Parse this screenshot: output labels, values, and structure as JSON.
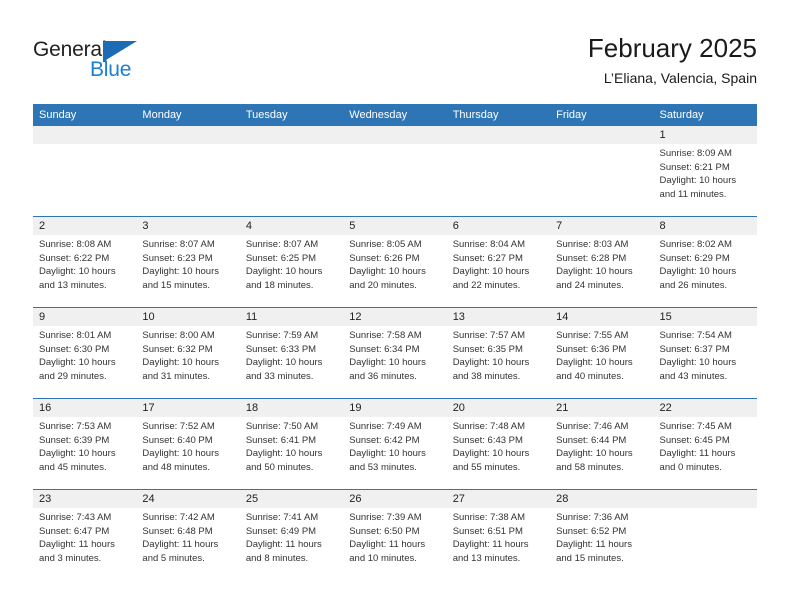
{
  "brand": {
    "name_part1": "General",
    "name_part2": "Blue",
    "accent_color": "#1b7fd4",
    "flag_color": "#1b6cb5"
  },
  "header": {
    "title": "February 2025",
    "subtitle": "L’Eliana, Valencia, Spain"
  },
  "theme": {
    "header_blue": "#2e75b6",
    "daynum_band": "#f0f0f0",
    "text": "#333333"
  },
  "calendar": {
    "weekdays": [
      "Sunday",
      "Monday",
      "Tuesday",
      "Wednesday",
      "Thursday",
      "Friday",
      "Saturday"
    ],
    "weeks": [
      [
        {
          "day": "",
          "lines": []
        },
        {
          "day": "",
          "lines": []
        },
        {
          "day": "",
          "lines": []
        },
        {
          "day": "",
          "lines": []
        },
        {
          "day": "",
          "lines": []
        },
        {
          "day": "",
          "lines": []
        },
        {
          "day": "1",
          "lines": [
            "Sunrise: 8:09 AM",
            "Sunset: 6:21 PM",
            "Daylight: 10 hours",
            "and 11 minutes."
          ]
        }
      ],
      [
        {
          "day": "2",
          "lines": [
            "Sunrise: 8:08 AM",
            "Sunset: 6:22 PM",
            "Daylight: 10 hours",
            "and 13 minutes."
          ]
        },
        {
          "day": "3",
          "lines": [
            "Sunrise: 8:07 AM",
            "Sunset: 6:23 PM",
            "Daylight: 10 hours",
            "and 15 minutes."
          ]
        },
        {
          "day": "4",
          "lines": [
            "Sunrise: 8:07 AM",
            "Sunset: 6:25 PM",
            "Daylight: 10 hours",
            "and 18 minutes."
          ]
        },
        {
          "day": "5",
          "lines": [
            "Sunrise: 8:05 AM",
            "Sunset: 6:26 PM",
            "Daylight: 10 hours",
            "and 20 minutes."
          ]
        },
        {
          "day": "6",
          "lines": [
            "Sunrise: 8:04 AM",
            "Sunset: 6:27 PM",
            "Daylight: 10 hours",
            "and 22 minutes."
          ]
        },
        {
          "day": "7",
          "lines": [
            "Sunrise: 8:03 AM",
            "Sunset: 6:28 PM",
            "Daylight: 10 hours",
            "and 24 minutes."
          ]
        },
        {
          "day": "8",
          "lines": [
            "Sunrise: 8:02 AM",
            "Sunset: 6:29 PM",
            "Daylight: 10 hours",
            "and 26 minutes."
          ]
        }
      ],
      [
        {
          "day": "9",
          "lines": [
            "Sunrise: 8:01 AM",
            "Sunset: 6:30 PM",
            "Daylight: 10 hours",
            "and 29 minutes."
          ]
        },
        {
          "day": "10",
          "lines": [
            "Sunrise: 8:00 AM",
            "Sunset: 6:32 PM",
            "Daylight: 10 hours",
            "and 31 minutes."
          ]
        },
        {
          "day": "11",
          "lines": [
            "Sunrise: 7:59 AM",
            "Sunset: 6:33 PM",
            "Daylight: 10 hours",
            "and 33 minutes."
          ]
        },
        {
          "day": "12",
          "lines": [
            "Sunrise: 7:58 AM",
            "Sunset: 6:34 PM",
            "Daylight: 10 hours",
            "and 36 minutes."
          ]
        },
        {
          "day": "13",
          "lines": [
            "Sunrise: 7:57 AM",
            "Sunset: 6:35 PM",
            "Daylight: 10 hours",
            "and 38 minutes."
          ]
        },
        {
          "day": "14",
          "lines": [
            "Sunrise: 7:55 AM",
            "Sunset: 6:36 PM",
            "Daylight: 10 hours",
            "and 40 minutes."
          ]
        },
        {
          "day": "15",
          "lines": [
            "Sunrise: 7:54 AM",
            "Sunset: 6:37 PM",
            "Daylight: 10 hours",
            "and 43 minutes."
          ]
        }
      ],
      [
        {
          "day": "16",
          "lines": [
            "Sunrise: 7:53 AM",
            "Sunset: 6:39 PM",
            "Daylight: 10 hours",
            "and 45 minutes."
          ]
        },
        {
          "day": "17",
          "lines": [
            "Sunrise: 7:52 AM",
            "Sunset: 6:40 PM",
            "Daylight: 10 hours",
            "and 48 minutes."
          ]
        },
        {
          "day": "18",
          "lines": [
            "Sunrise: 7:50 AM",
            "Sunset: 6:41 PM",
            "Daylight: 10 hours",
            "and 50 minutes."
          ]
        },
        {
          "day": "19",
          "lines": [
            "Sunrise: 7:49 AM",
            "Sunset: 6:42 PM",
            "Daylight: 10 hours",
            "and 53 minutes."
          ]
        },
        {
          "day": "20",
          "lines": [
            "Sunrise: 7:48 AM",
            "Sunset: 6:43 PM",
            "Daylight: 10 hours",
            "and 55 minutes."
          ]
        },
        {
          "day": "21",
          "lines": [
            "Sunrise: 7:46 AM",
            "Sunset: 6:44 PM",
            "Daylight: 10 hours",
            "and 58 minutes."
          ]
        },
        {
          "day": "22",
          "lines": [
            "Sunrise: 7:45 AM",
            "Sunset: 6:45 PM",
            "Daylight: 11 hours",
            "and 0 minutes."
          ]
        }
      ],
      [
        {
          "day": "23",
          "lines": [
            "Sunrise: 7:43 AM",
            "Sunset: 6:47 PM",
            "Daylight: 11 hours",
            "and 3 minutes."
          ]
        },
        {
          "day": "24",
          "lines": [
            "Sunrise: 7:42 AM",
            "Sunset: 6:48 PM",
            "Daylight: 11 hours",
            "and 5 minutes."
          ]
        },
        {
          "day": "25",
          "lines": [
            "Sunrise: 7:41 AM",
            "Sunset: 6:49 PM",
            "Daylight: 11 hours",
            "and 8 minutes."
          ]
        },
        {
          "day": "26",
          "lines": [
            "Sunrise: 7:39 AM",
            "Sunset: 6:50 PM",
            "Daylight: 11 hours",
            "and 10 minutes."
          ]
        },
        {
          "day": "27",
          "lines": [
            "Sunrise: 7:38 AM",
            "Sunset: 6:51 PM",
            "Daylight: 11 hours",
            "and 13 minutes."
          ]
        },
        {
          "day": "28",
          "lines": [
            "Sunrise: 7:36 AM",
            "Sunset: 6:52 PM",
            "Daylight: 11 hours",
            "and 15 minutes."
          ]
        },
        {
          "day": "",
          "lines": []
        }
      ]
    ]
  }
}
